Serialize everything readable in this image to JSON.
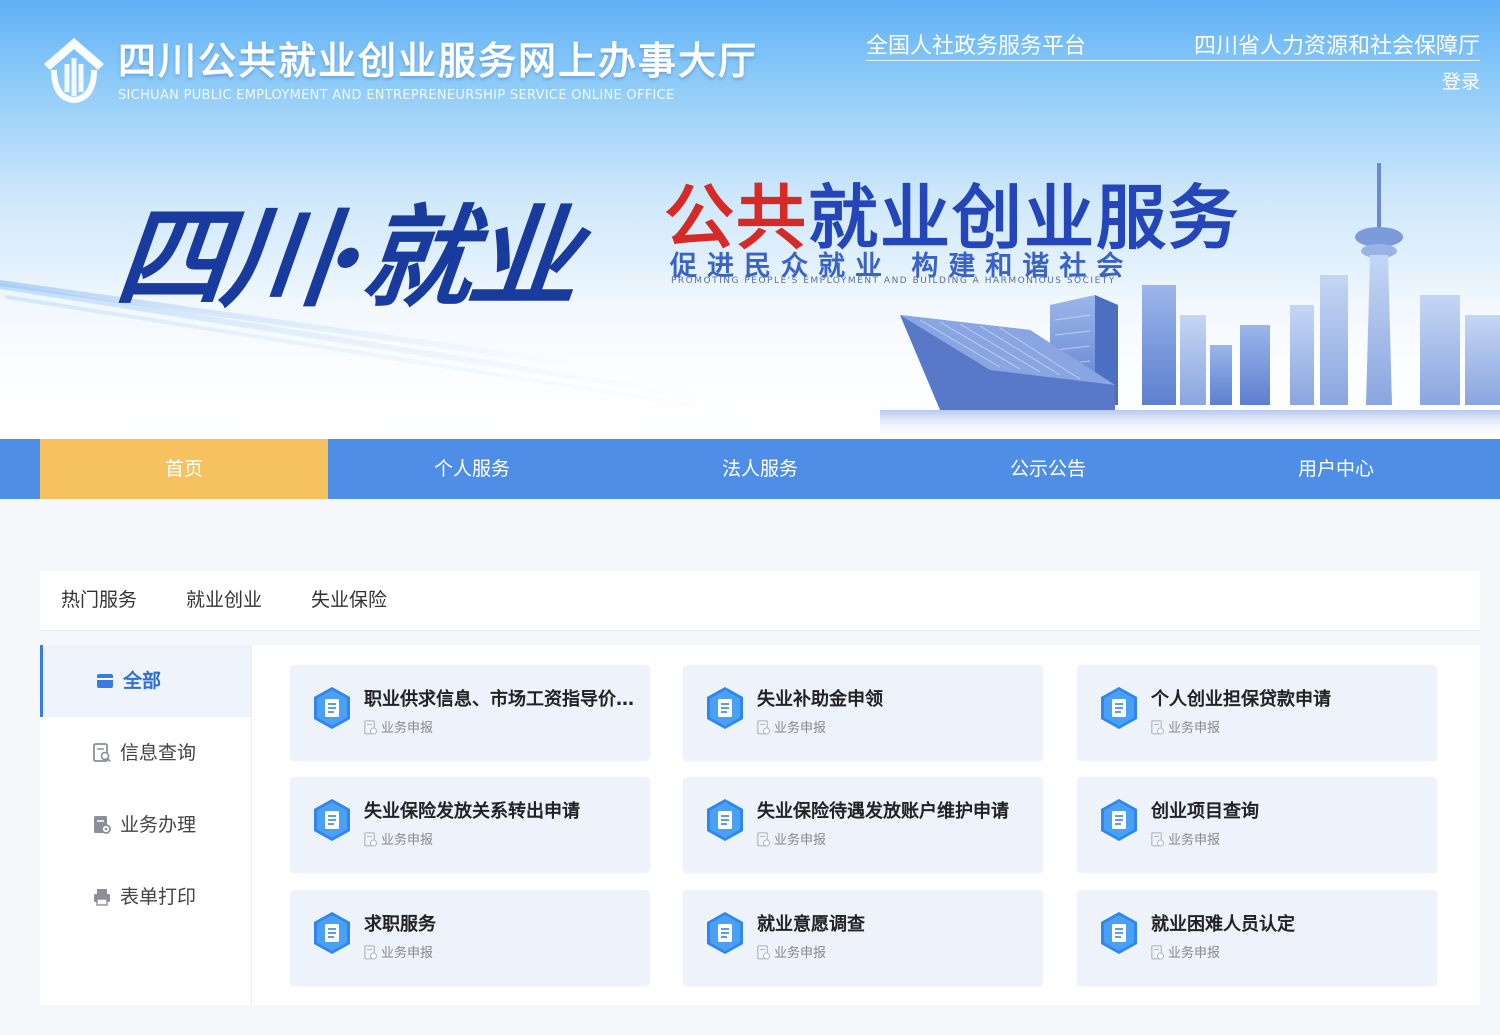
{
  "header": {
    "site_title": "四川公共就业创业服务网上办事大厅",
    "site_subtitle": "SICHUAN PUBLIC EMPLOYMENT AND ENTREPRENEURSHIP SERVICE ONLINE OFFICE",
    "links": [
      "全国人社政务服务平台",
      "四川省人力资源和社会保障厅"
    ],
    "login": "登录"
  },
  "banner": {
    "calligraphy": "四川·就业",
    "main_red": "公共",
    "main_blue": "就业创业服务",
    "sub": "促进民众就业  构建和谐社会",
    "sub_en": "PROMOTING PEOPLE'S EMPLOYMENT AND BUILDING A HARMONIOUS SOCIETY"
  },
  "nav": [
    "首页",
    "个人服务",
    "法人服务",
    "公示公告",
    "用户中心"
  ],
  "nav_active": "首页",
  "tabs": [
    "热门服务",
    "就业创业",
    "失业保险"
  ],
  "sidebar": [
    {
      "label": "全部",
      "icon": "card-icon",
      "active": true
    },
    {
      "label": "信息查询",
      "icon": "doc-search-icon",
      "active": false
    },
    {
      "label": "业务办理",
      "icon": "doc-gear-icon",
      "active": false
    },
    {
      "label": "表单打印",
      "icon": "printer-icon",
      "active": false
    }
  ],
  "services": [
    {
      "title": "职业供求信息、市场工资指导价位查询",
      "tag": "业务申报"
    },
    {
      "title": "失业补助金申领",
      "tag": "业务申报"
    },
    {
      "title": "个人创业担保贷款申请",
      "tag": "业务申报"
    },
    {
      "title": "失业保险发放关系转出申请",
      "tag": "业务申报"
    },
    {
      "title": "失业保险待遇发放账户维护申请",
      "tag": "业务申报"
    },
    {
      "title": "创业项目查询",
      "tag": "业务申报"
    },
    {
      "title": "求职服务",
      "tag": "业务申报"
    },
    {
      "title": "就业意愿调查",
      "tag": "业务申报"
    },
    {
      "title": "就业困难人员认定",
      "tag": "业务申报"
    }
  ],
  "colors": {
    "nav_bg": "#4f8ee6",
    "nav_active": "#f6c25f",
    "accent": "#3a7be0",
    "card_bg": "#edf2fb",
    "slogan_red": "#d52a26",
    "slogan_blue": "#2546b8"
  }
}
